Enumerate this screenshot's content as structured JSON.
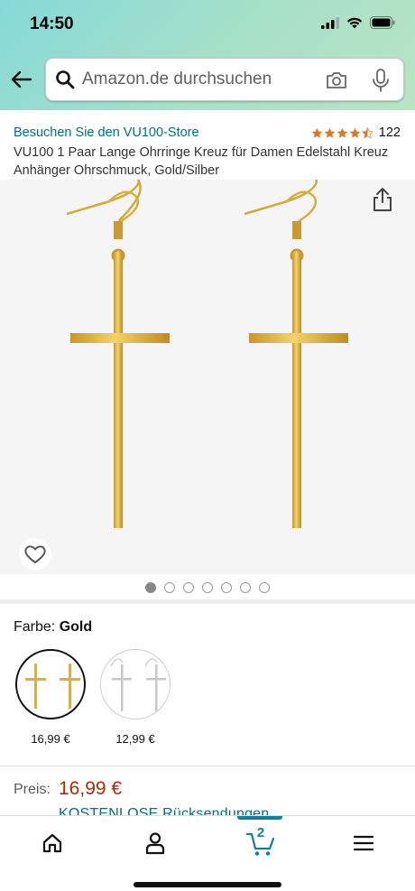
{
  "status": {
    "time": "14:50"
  },
  "search": {
    "placeholder": "Amazon.de durchsuchen"
  },
  "product": {
    "store_link": "Besuchen Sie den VU100-Store",
    "rating": 4.5,
    "rating_count": "122",
    "title": "VU100 1 Paar Lange Ohrringe Kreuz für Damen Edelstahl Kreuz Anhänger Ohrschmuck, Gold/Silber"
  },
  "gallery": {
    "image_count": 7,
    "active_index": 0
  },
  "color": {
    "label": "Farbe:",
    "selected": "Gold",
    "options": [
      {
        "name": "Gold",
        "price": "16,99 €",
        "color": "#d9b23a"
      },
      {
        "name": "Silber",
        "price": "12,99 €",
        "color": "#c8c8c8"
      }
    ]
  },
  "price": {
    "label": "Preis:",
    "value": "16,99 €",
    "returns": "KOSTENLOSE Rücksendungen"
  },
  "nav": {
    "cart_count": "2"
  },
  "colors": {
    "accent": "#0e7ea3",
    "link": "#007185",
    "price": "#b12704",
    "star": "#de7921"
  }
}
